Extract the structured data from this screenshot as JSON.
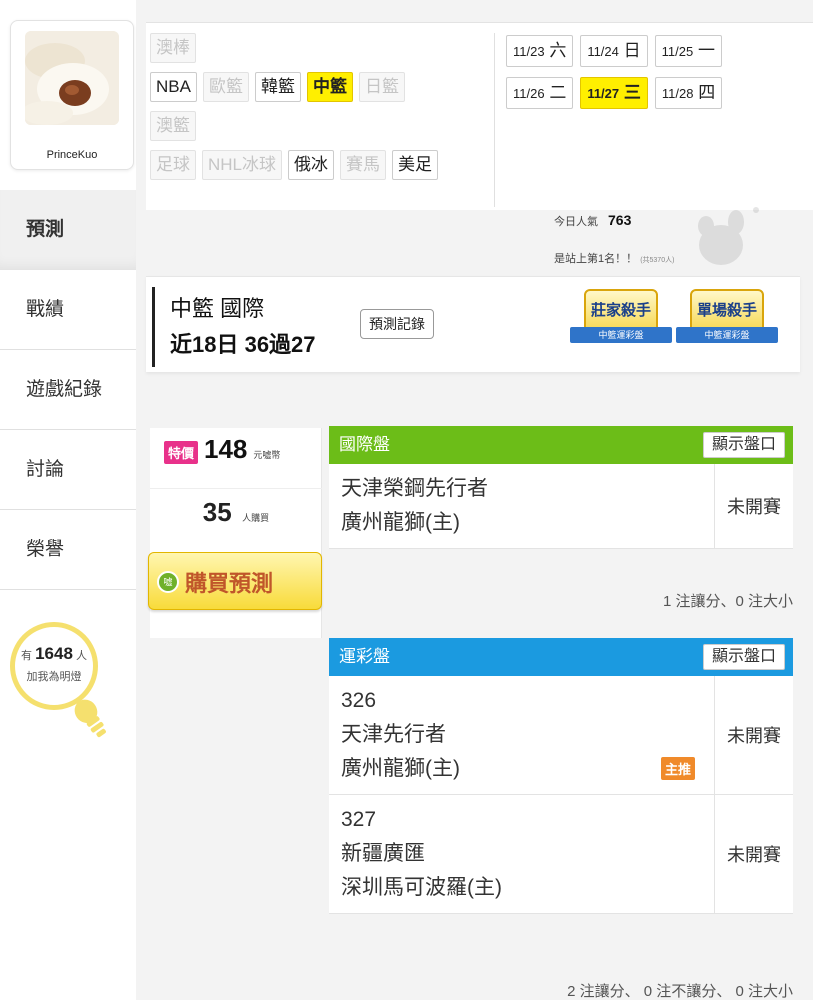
{
  "profile": {
    "username": "PrinceKuo"
  },
  "sidebar": {
    "items": [
      {
        "label": "預測",
        "active": true
      },
      {
        "label": "戰績",
        "active": false
      },
      {
        "label": "遊戲紀錄",
        "active": false
      },
      {
        "label": "討論",
        "active": false
      },
      {
        "label": "榮譽",
        "active": false
      }
    ]
  },
  "lamp": {
    "prefix": "有",
    "count": "1648",
    "suffix": "人",
    "line2": "加我為明燈"
  },
  "sports": {
    "row1": [
      {
        "label": "澳棒",
        "state": "dim"
      }
    ],
    "row2": [
      {
        "label": "NBA",
        "state": "normal"
      },
      {
        "label": "歐籃",
        "state": "dim"
      },
      {
        "label": "韓籃",
        "state": "normal"
      },
      {
        "label": "中籃",
        "state": "active"
      },
      {
        "label": "日籃",
        "state": "dim"
      }
    ],
    "row3": [
      {
        "label": "澳籃",
        "state": "dim"
      }
    ],
    "row4": [
      {
        "label": "足球",
        "state": "dim"
      },
      {
        "label": "NHL冰球",
        "state": "dim"
      },
      {
        "label": "俄冰",
        "state": "normal"
      },
      {
        "label": "賽馬",
        "state": "dim"
      },
      {
        "label": "美足",
        "state": "normal"
      }
    ]
  },
  "dates": {
    "row1": [
      {
        "date": "11/23",
        "day": "六",
        "active": false
      },
      {
        "date": "11/24",
        "day": "日",
        "active": false
      },
      {
        "date": "11/25",
        "day": "一",
        "active": false
      }
    ],
    "row2": [
      {
        "date": "11/26",
        "day": "二",
        "active": false
      },
      {
        "date": "11/27",
        "day": "三",
        "active": true
      },
      {
        "date": "11/28",
        "day": "四",
        "active": false
      }
    ]
  },
  "popularity": {
    "label": "今日人氣",
    "value": "763",
    "rank_text": "是站上第1名！！",
    "rank_note": "(共5370人)"
  },
  "header": {
    "league": "中籃 國際",
    "record": "近18日 36過27",
    "record_button": "預測記錄",
    "badges": [
      {
        "title": "莊家殺手",
        "ribbon": "中籃運彩盤"
      },
      {
        "title": "單場殺手",
        "ribbon": "中籃運彩盤"
      }
    ]
  },
  "purchase": {
    "special_tag": "特價",
    "price": "148",
    "price_unit": "元噓幣",
    "buyers": "35",
    "buyers_unit": "人購買",
    "buy_icon": "噓",
    "buy_label": "購買預測"
  },
  "international": {
    "title": "國際盤",
    "show_button": "顯示盤口",
    "matches": [
      {
        "lines": [
          "天津榮鋼先行者",
          "廣州龍獅(主)"
        ],
        "status": "未開賽"
      }
    ],
    "summary": "1 注讓分、0 注大小"
  },
  "lottery": {
    "title": "運彩盤",
    "show_button": "顯示盤口",
    "matches": [
      {
        "lines": [
          "326",
          "天津先行者",
          "廣州龍獅(主)"
        ],
        "status": "未開賽",
        "tag": "主推"
      },
      {
        "lines": [
          "327",
          "新疆廣匯",
          "深圳馬可波羅(主)"
        ],
        "status": "未開賽"
      }
    ],
    "summary": "2 注讓分、 0 注不讓分、 0 注大小"
  },
  "colors": {
    "accent_yellow": "#ffef00",
    "green_header": "#6cbd18",
    "blue_header": "#1b9ae0",
    "special_pink": "#e8318a",
    "main_tag_orange": "#f08a2a"
  }
}
